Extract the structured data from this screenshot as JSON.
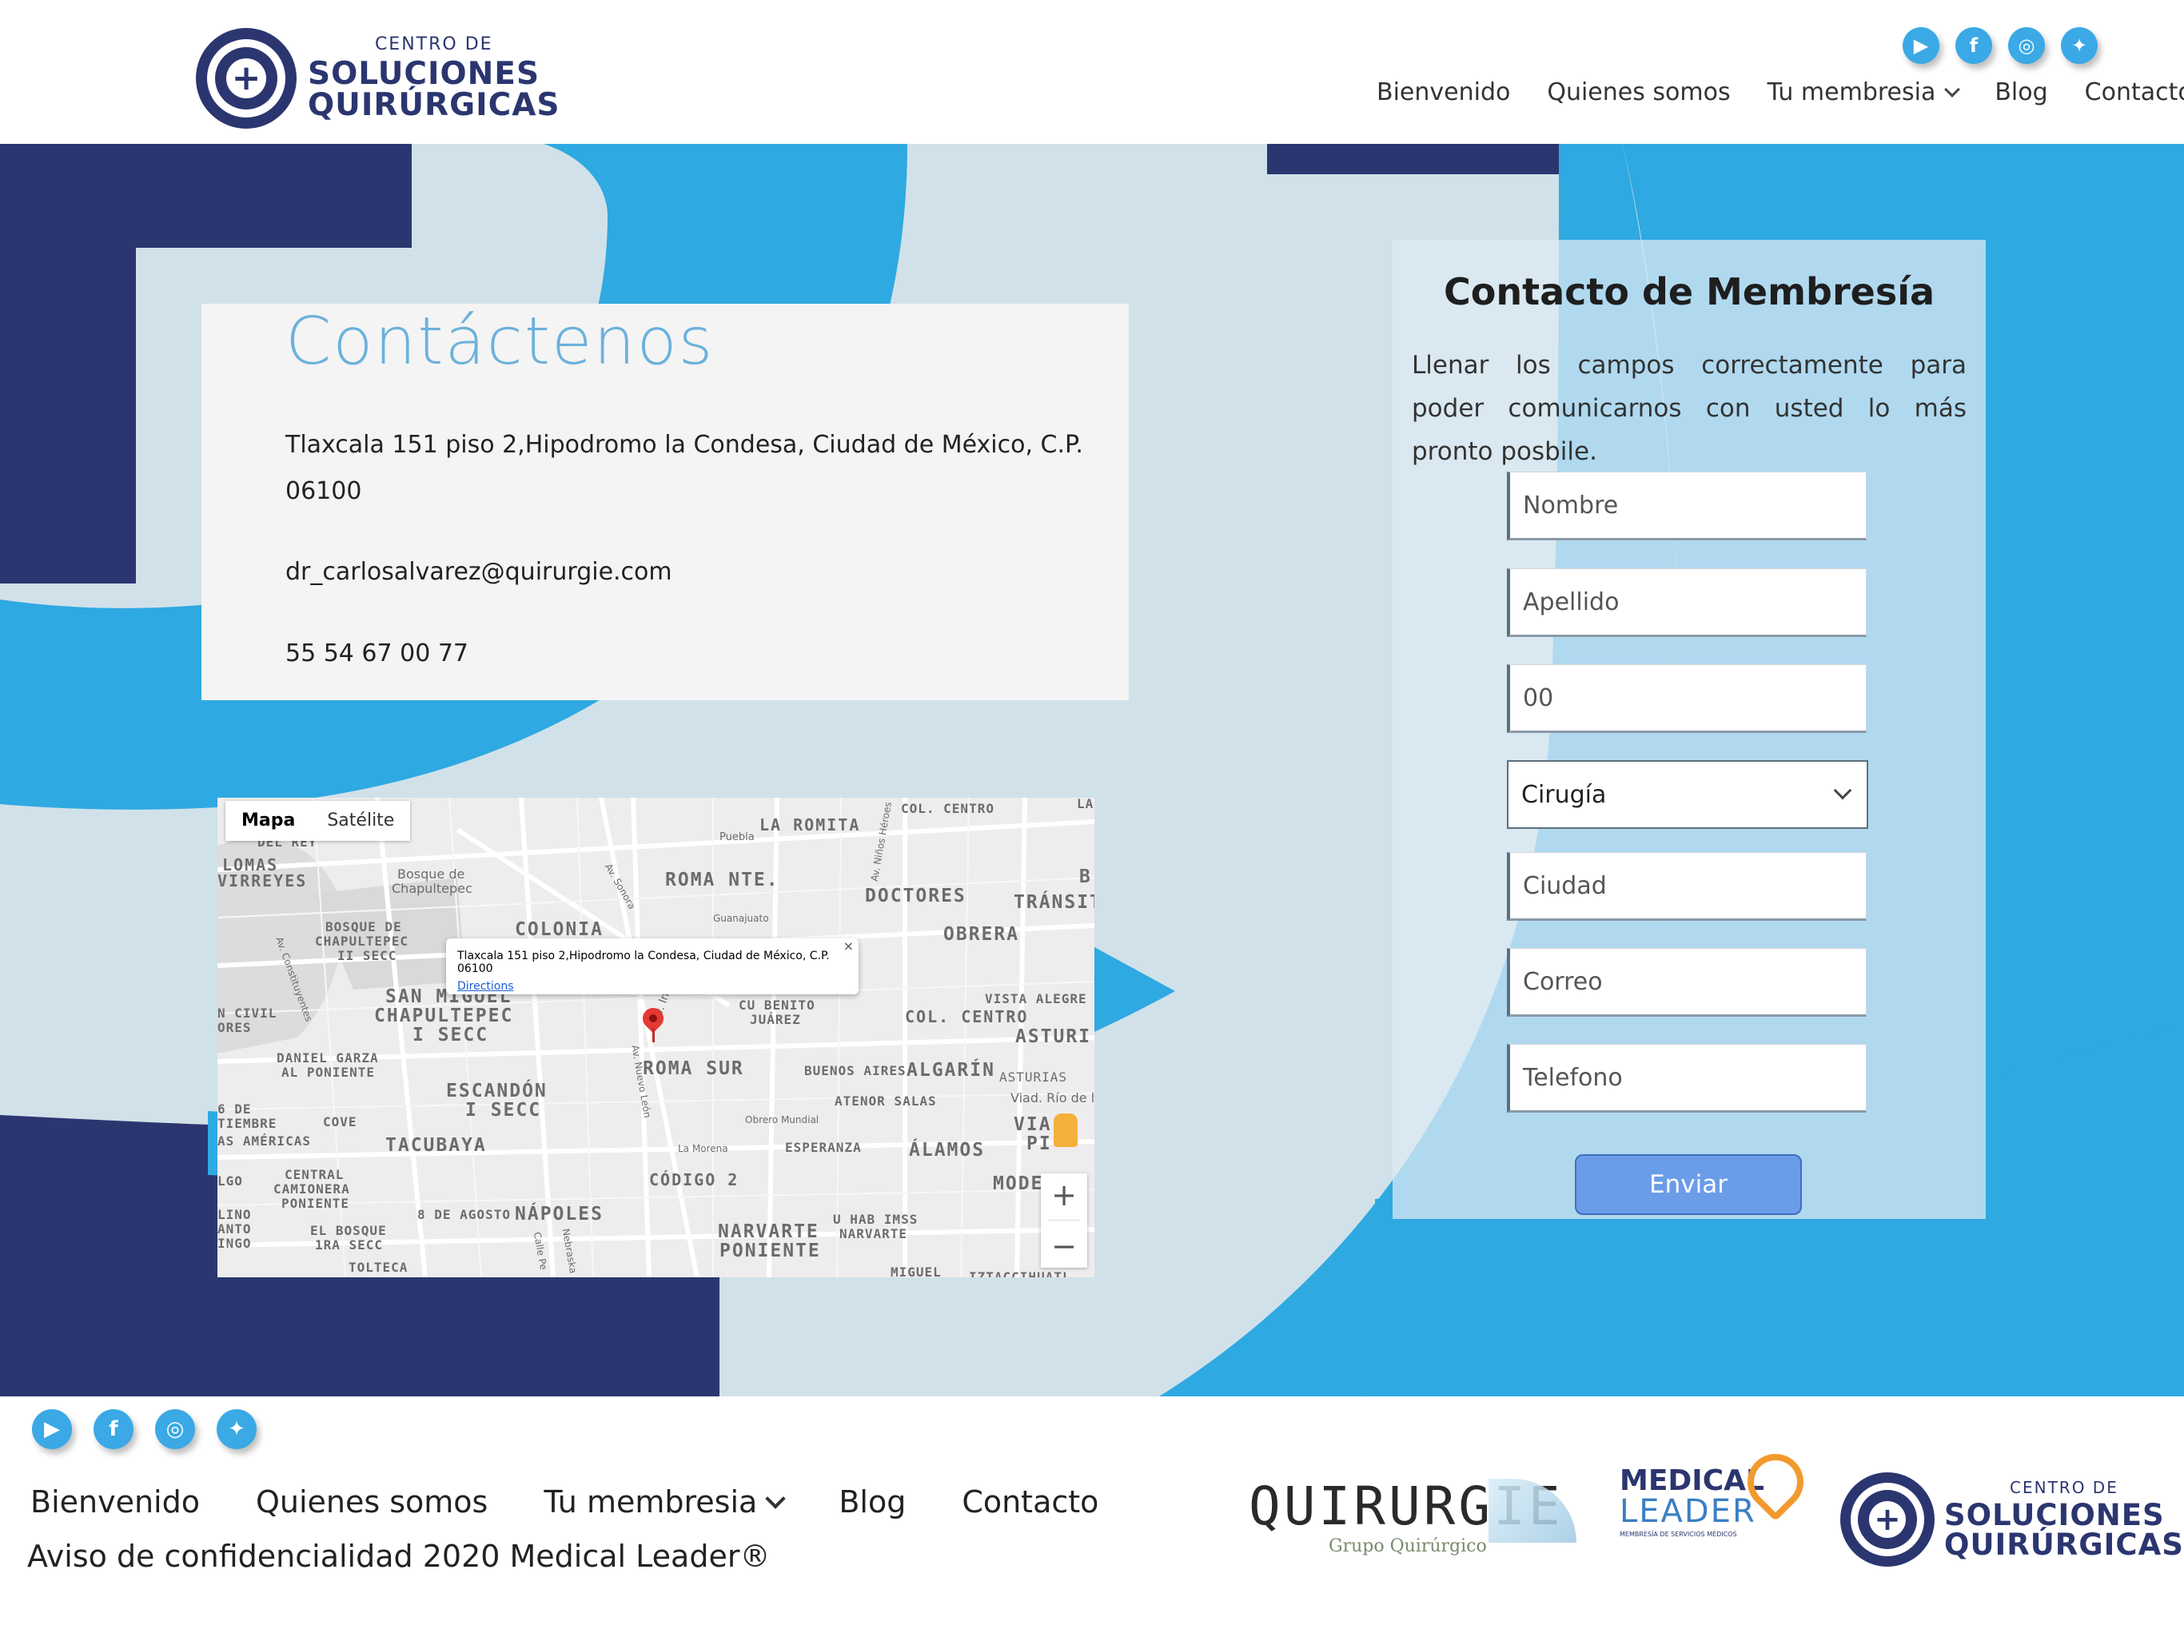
{
  "header": {
    "logo": {
      "top": "CENTRO DE",
      "line1": "SOLUCIONES",
      "line2": "QUIRÚRGICAS"
    },
    "social_icons": [
      "youtube-icon",
      "facebook-icon",
      "instagram-icon",
      "twitter-icon"
    ],
    "nav": {
      "bienvenido": "Bienvenido",
      "quienes": "Quienes somos",
      "membresia": "Tu membresia",
      "blog": "Blog",
      "contacto": "Contacto"
    }
  },
  "contact": {
    "title": "Contáctenos",
    "address": "Tlaxcala 151 piso 2,Hipodromo la Condesa, Ciudad de México, C.P. 06100",
    "email": "dr_carlosalvarez@quirurgie.com",
    "phone": "55 54 67 00 77"
  },
  "map": {
    "tabs": {
      "map": "Mapa",
      "satellite": "Satélite"
    },
    "popup": {
      "address": "Tlaxcala 151 piso 2,Hipodromo la Condesa, Ciudad de México, C.P. 06100",
      "directions": "Directions",
      "close": "×"
    },
    "zoom_in": "+",
    "zoom_out": "−",
    "labels": {
      "la_romita": "LA ROMITA",
      "col_centro_top": "COL. CENTRO",
      "roma_nte": "ROMA NTE.",
      "doctores": "DOCTORES",
      "transito": "TRÁNSIT",
      "obrera": "OBRERA",
      "lomas": "LOMAS",
      "virreyes": "VIRREYES",
      "bosque_chap": "Bosque de",
      "bosque_chap2": "Chapultepec",
      "bosque_chap_iii_1": "BOSQUE DE",
      "bosque_chap_iii_2": "CHAPULTEPEC",
      "bosque_chap_iii_3": "II SECC",
      "colonia": "COLONIA",
      "san_miguel_1": "SAN MIGUEL",
      "san_miguel_2": "CHAPULTEPEC",
      "san_miguel_3": "I SECC",
      "cu_benito_1": "CU BENITO",
      "cu_benito_2": "JUÁREZ",
      "vista_alegre": "VISTA ALEGRE",
      "col_centro_mid": "COL. CENTRO",
      "asturias_big": "ASTURI",
      "civil_1": "N CIVIL",
      "civil_2": "ORES",
      "daniel_1": "DANIEL GARZA",
      "daniel_2": "AL PONIENTE",
      "roma_sur": "ROMA SUR",
      "buenos_aires": "BUENOS AIRES",
      "algarin": "ALGARÍN",
      "asturias_small": "ASTURIAS",
      "escandon_1": "ESCANDÓN",
      "escandon_2": "I SECC",
      "atenor": "ATENOR SALAS",
      "viad_rio": "Viad. Río de la Pi",
      "sept_1": "6 DE",
      "sept_2": "TIEMBRE",
      "cove": "COVE",
      "americas": "AS AMÉRICAS",
      "tacubaya": "TACUBAYA",
      "esperanza": "ESPERANZA",
      "alamos": "ÁLAMOS",
      "via": "VIA",
      "piedad": "PI",
      "lgo": "LGO",
      "central_1": "CENTRAL",
      "central_2": "CAMIONERA",
      "central_3": "PONIENTE",
      "codigo": "CÓDIGO 2",
      "moderna": "MODERNA",
      "lino_1": "LINO",
      "lino_2": "ANTO",
      "lino_3": "INGO",
      "agosto": "8 DE AGOSTO",
      "napoles": "NÁPOLES",
      "bosque_1ra_1": "EL BOSQUE",
      "bosque_1ra_2": "1RA SECC",
      "narvarte_pon_1": "NARVARTE",
      "narvarte_pon_2": "PONIENTE",
      "hab_imss_1": "U HAB IMSS",
      "hab_imss_2": "NARVARTE",
      "tolteca": "TOLTECA",
      "miguel": "MIGUEL",
      "iztacc": "IZTACCIHUATL",
      "puebla": "Puebla",
      "guanajuato": "Guanajuato",
      "la_morena": "La Morena",
      "obrero_mundial": "Obrero Mundial",
      "av_sonora": "Av. Sonora",
      "av_insurg": "Av. Insurg",
      "av_nuevo_leon": "Av. Nuevo León",
      "av_ninos": "Av. Niños Héroes",
      "av_constituyentes": "Av. Constituyentes",
      "calle_pe": "Calle Pe",
      "nebraska": "Nebraska",
      "la_top": "LA",
      "del_rey": "DEL REY",
      "b_right": "B"
    }
  },
  "form": {
    "title": "Contacto de Membresía",
    "description": "Llenar los campos correctamente para poder comunicarnos con usted lo más pronto posbile.",
    "nombre_placeholder": "Nombre",
    "apellido_placeholder": "Apellido",
    "age_value": "00",
    "specialty_selected": "Cirugía",
    "ciudad_placeholder": "Ciudad",
    "correo_placeholder": "Correo",
    "telefono_placeholder": "Telefono",
    "submit": "Enviar"
  },
  "footer": {
    "social_icons": [
      "youtube-icon",
      "facebook-icon",
      "instagram-icon",
      "twitter-icon"
    ],
    "nav": {
      "bienvenido": "Bienvenido",
      "quienes": "Quienes somos",
      "membresia": "Tu membresia",
      "blog": "Blog",
      "contacto": "Contacto"
    },
    "notice": "Aviso de confidencialidad 2020 Medical Leader®",
    "quirurgie": {
      "name": "QUIRURGIE",
      "tagline": "Grupo Quirúrgico"
    },
    "medical_leader": {
      "line1": "MEDICAL",
      "line2": "LEADER",
      "tagline": "MEMBRESÍA DE SERVICIOS MÉDICOS"
    },
    "logo": {
      "top": "CENTRO DE",
      "line1": "SOLUCIONES",
      "line2": "QUIRÚRGICAS"
    }
  },
  "colors": {
    "navy": "#2b3670",
    "sky": "#2fa9e1",
    "background": "#d1e1ea",
    "button": "#6b9ce8",
    "title_blue": "#6cb1dc"
  }
}
